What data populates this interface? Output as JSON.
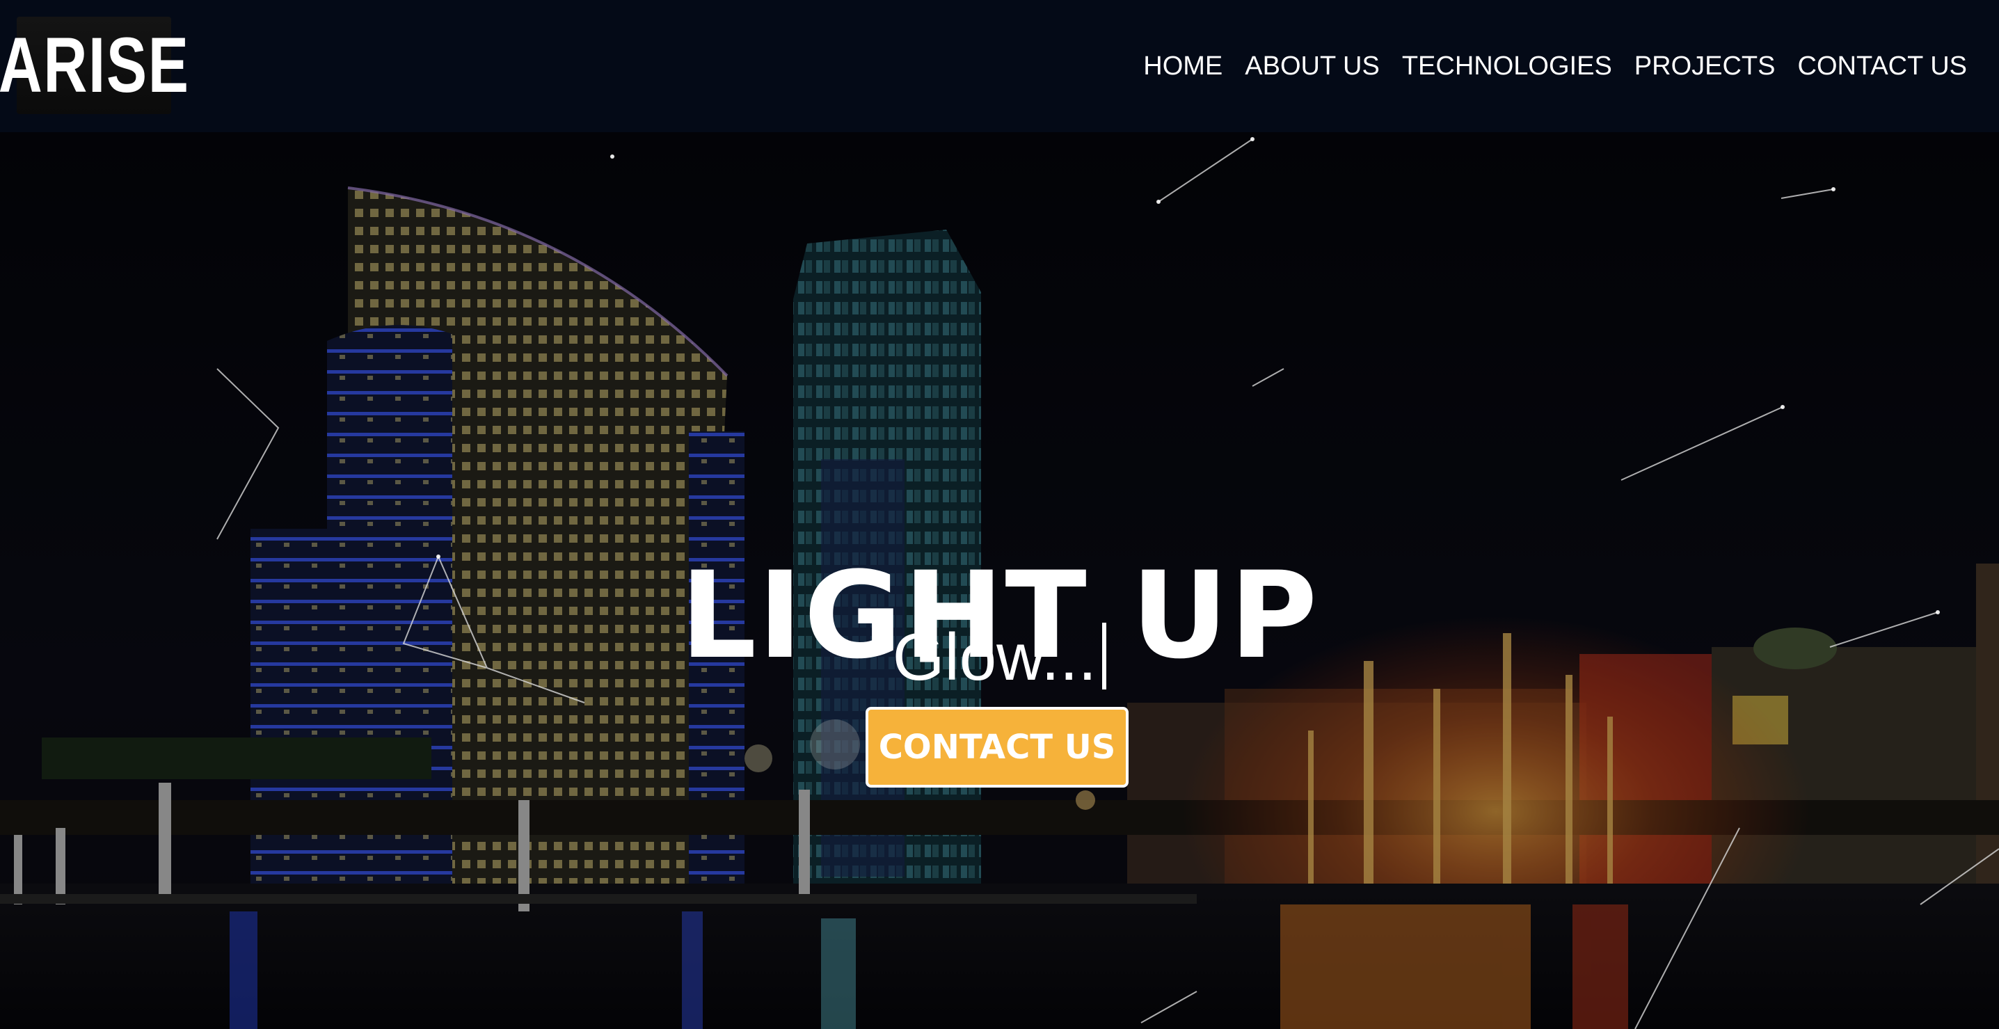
{
  "header": {
    "logo_text": "ARISE",
    "nav": [
      {
        "label": "HOME"
      },
      {
        "label": "ABOUT US"
      },
      {
        "label": "TECHNOLOGIES"
      },
      {
        "label": "PROJECTS"
      },
      {
        "label": "CONTACT US"
      }
    ]
  },
  "hero": {
    "title": "LIGHT UP",
    "subtitle": "Glow...",
    "cta_label": "CONTACT US",
    "background": "night city skyline over marina with fountains",
    "colors": {
      "cta_background": "#f6b23a",
      "header_background": "#040a17"
    }
  }
}
